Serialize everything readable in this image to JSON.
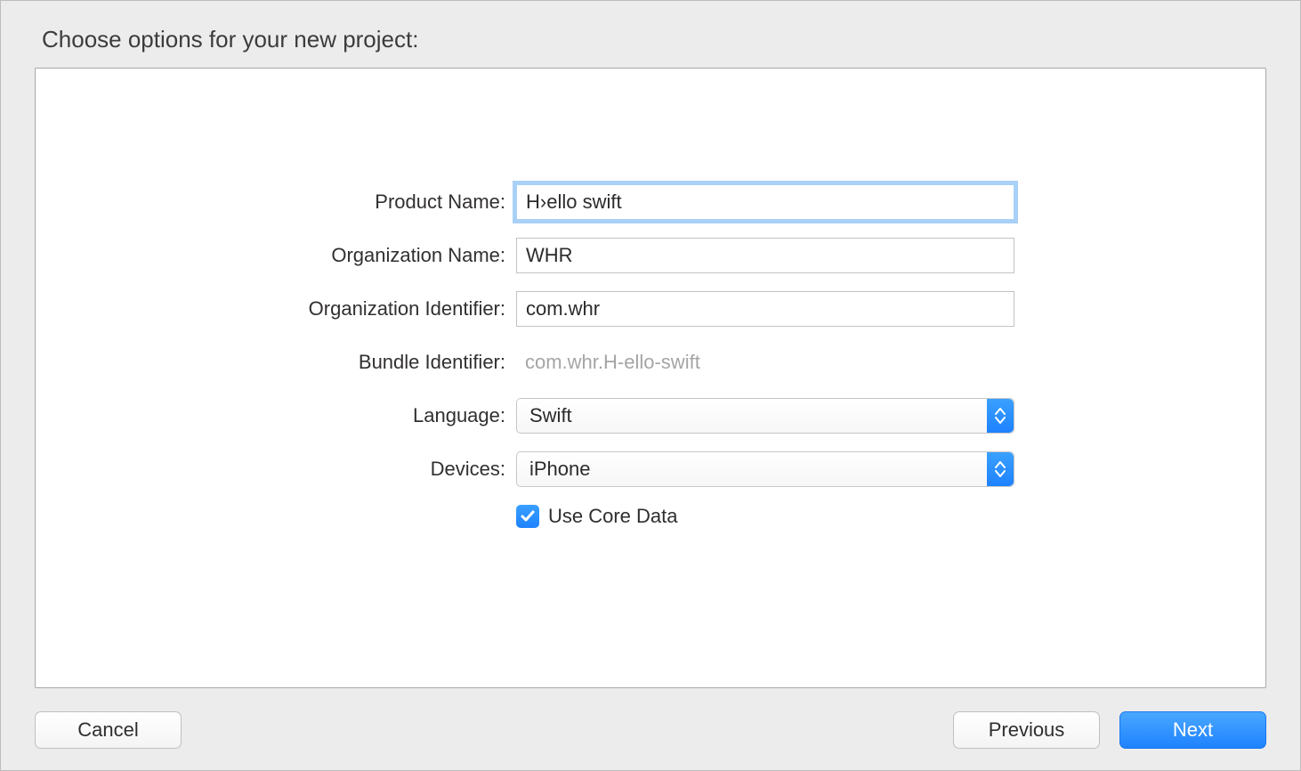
{
  "title": "Choose options for your new project:",
  "fields": {
    "product_name": {
      "label": "Product Name:",
      "value": "H›ello swift"
    },
    "organization_name": {
      "label": "Organization Name:",
      "value": "WHR"
    },
    "organization_identifier": {
      "label": "Organization Identifier:",
      "value": "com.whr"
    },
    "bundle_identifier": {
      "label": "Bundle Identifier:",
      "value": "com.whr.H-ello-swift"
    },
    "language": {
      "label": "Language:",
      "value": "Swift"
    },
    "devices": {
      "label": "Devices:",
      "value": "iPhone"
    },
    "use_core_data": {
      "label": "Use Core Data",
      "checked": true
    }
  },
  "buttons": {
    "cancel": "Cancel",
    "previous": "Previous",
    "next": "Next"
  }
}
